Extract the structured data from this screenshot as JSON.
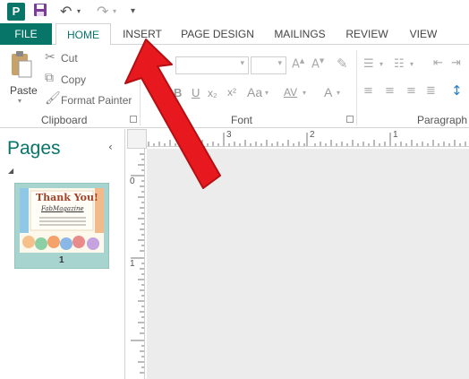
{
  "titlebar": {
    "logo_letter": "P",
    "save_icon": "save-icon",
    "undo_icon": "undo-icon",
    "redo_icon": "redo-icon",
    "customize_icon": "customize-qat-icon"
  },
  "tabs": [
    {
      "label": "FILE"
    },
    {
      "label": "HOME"
    },
    {
      "label": "INSERT"
    },
    {
      "label": "PAGE DESIGN"
    },
    {
      "label": "MAILINGS"
    },
    {
      "label": "REVIEW"
    },
    {
      "label": "VIEW"
    }
  ],
  "ribbon": {
    "clipboard": {
      "paste_label": "Paste",
      "cut_label": "Cut",
      "copy_label": "Copy",
      "format_painter_label": "Format Painter",
      "group_label": "Clipboard"
    },
    "font": {
      "group_label": "Font",
      "bold": "B",
      "italic": "I",
      "underline": "U",
      "subscript": "x₂",
      "superscript": "x²",
      "change_case": "Aa",
      "char_spacing": "AV",
      "font_color": "A"
    },
    "paragraph": {
      "group_label": "Paragraph"
    }
  },
  "pages_pane": {
    "title": "Pages",
    "collapse_icon": "chevron-left-icon",
    "thumbnails": [
      {
        "page_number": "1",
        "card_title": "Thank You!",
        "card_subtitle": "FabMagazine"
      }
    ]
  },
  "rulers": {
    "horizontal": [
      "3",
      "2",
      "1"
    ],
    "vertical": [
      "0",
      "1"
    ]
  },
  "annotation": {
    "color": "#e8191e",
    "icon": "red-arrow-icon"
  },
  "colors": {
    "accent": "#077568",
    "ribbon_bg": "#ffffff",
    "workspace_bg": "#ececec"
  }
}
